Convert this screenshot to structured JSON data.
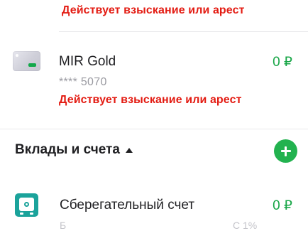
{
  "top_item": {
    "warning": "Действует взыскание или арест"
  },
  "card_item": {
    "title": "MIR Gold",
    "number": "**** 5070",
    "amount": "0 ₽",
    "warning": "Действует взыскание или арест",
    "icon": "bank-card-icon"
  },
  "section": {
    "title": "Вклады и счета",
    "toggle_icon": "caret-up-icon",
    "add_icon": "plus-icon"
  },
  "savings_item": {
    "title": "Сберегательный счет",
    "amount": "0 ₽",
    "icon": "safe-icon",
    "subtitle_partial_left": "Б",
    "subtitle_partial_right": "С     1%"
  },
  "colors": {
    "warning": "#e31b12",
    "accent_green": "#22b24f",
    "amount_green": "#18a647",
    "safe_teal": "#1ba39b"
  }
}
